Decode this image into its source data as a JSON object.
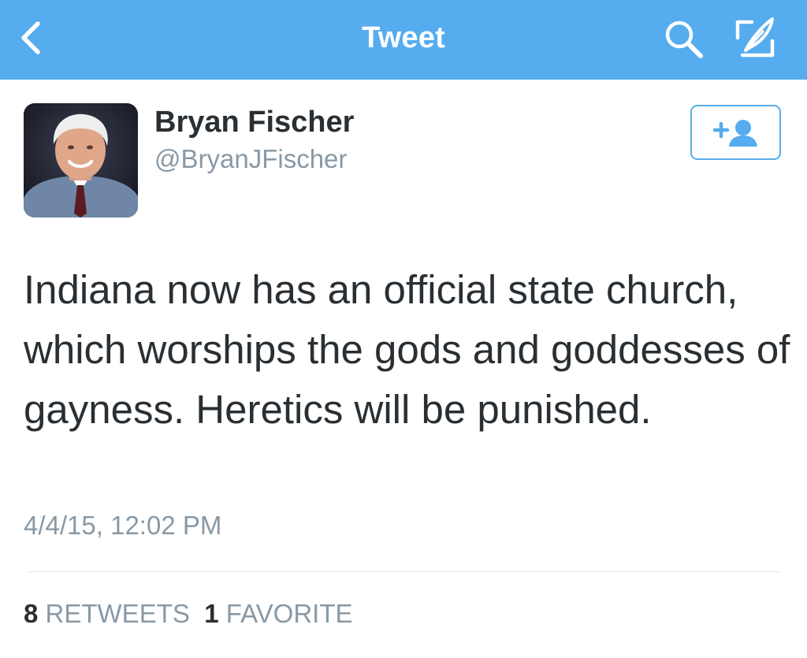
{
  "nav": {
    "title": "Tweet",
    "back_icon": "chevron-left-icon",
    "search_icon": "search-icon",
    "compose_icon": "compose-tweet-icon",
    "bar_color": "#55acee"
  },
  "user": {
    "display_name": "Bryan Fischer",
    "handle": "@BryanJFischer",
    "avatar": "profile-photo",
    "follow_icon": "add-user-icon"
  },
  "tweet": {
    "text": "Indiana now has an official state church, which worships the gods and goddesses of gayness. Heretics will be punished.",
    "timestamp": "4/4/15, 12:02 PM"
  },
  "stats": {
    "retweets_count": "8",
    "retweets_label": "RETWEETS",
    "favorites_count": "1",
    "favorites_label": "FAVORITE"
  },
  "colors": {
    "accent": "#55acee",
    "text_primary": "#292f33",
    "text_secondary": "#8899a6"
  }
}
